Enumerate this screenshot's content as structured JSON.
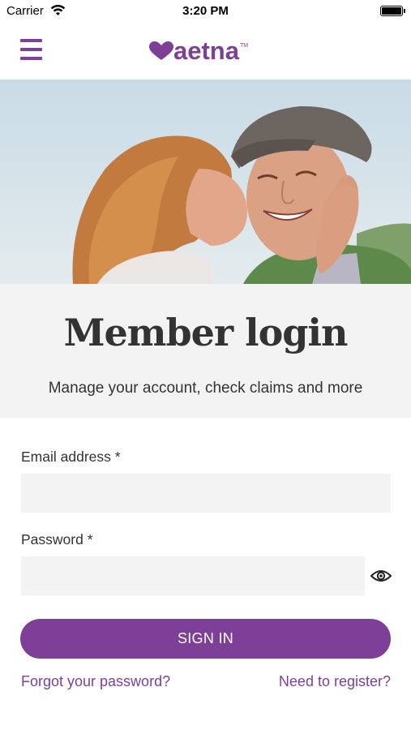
{
  "status_bar": {
    "carrier": "Carrier",
    "time": "3:20 PM"
  },
  "header": {
    "logo_text": "aetna",
    "logo_tm": "TM"
  },
  "hero": {
    "image": "photo of woman kissing smiling elderly man"
  },
  "login": {
    "title": "Member login",
    "subtitle": "Manage your account, check claims and more"
  },
  "form": {
    "email_label": "Email address *",
    "email_value": "",
    "password_label": "Password *",
    "password_value": "",
    "sign_in_label": "SIGN IN",
    "forgot_link": "Forgot your password?",
    "register_link": "Need to register?"
  },
  "colors": {
    "brand": "#7d3f98",
    "field_bg": "#f3f3f3",
    "panel_bg": "#f3f3f3",
    "text": "#333333"
  },
  "icons": [
    "wifi-icon",
    "battery-icon",
    "menu-icon",
    "heart-icon",
    "eye-icon"
  ]
}
